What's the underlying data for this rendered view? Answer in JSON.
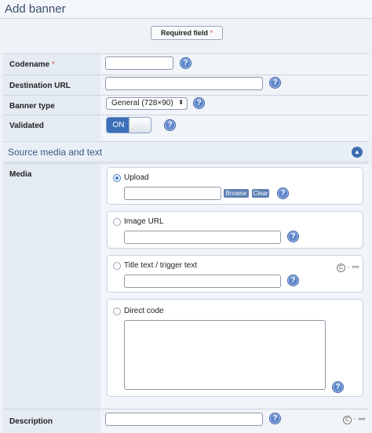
{
  "page": {
    "title": "Add banner"
  },
  "required_note": {
    "label": "Required field",
    "star": "*"
  },
  "fields": {
    "codename": {
      "label": "Codename",
      "star": "*",
      "value": "",
      "help": "?"
    },
    "destination_url": {
      "label": "Destination URL",
      "value": "",
      "help": "?"
    },
    "banner_type": {
      "label": "Banner type",
      "value": "General (728×90)",
      "caret": "⬍",
      "help": "?"
    },
    "validated": {
      "label": "Validated",
      "state": "ON",
      "help": "?"
    }
  },
  "section": {
    "title": "Source media and text",
    "toggle_icon": "▲"
  },
  "media": {
    "label": "Media",
    "upload": {
      "label": "Upload",
      "browse": "Browse",
      "clear": "Clear",
      "help": "?"
    },
    "image_url": {
      "label": "Image URL",
      "help": "?"
    },
    "title_text": {
      "label": "Title text / trigger text",
      "help": "?",
      "icon_c": "C",
      "icon_dot": "·",
      "icon_glasses": "👓"
    },
    "direct_code": {
      "label": "Direct code",
      "help": "?"
    }
  },
  "description": {
    "label": "Description",
    "value": "",
    "help": "?",
    "icon_c": "C",
    "icon_dot": "·",
    "icon_glasses": "👓"
  },
  "colors": {
    "accent": "#3d6fb8",
    "help": "#5d86c8",
    "required": "#d9534f"
  }
}
